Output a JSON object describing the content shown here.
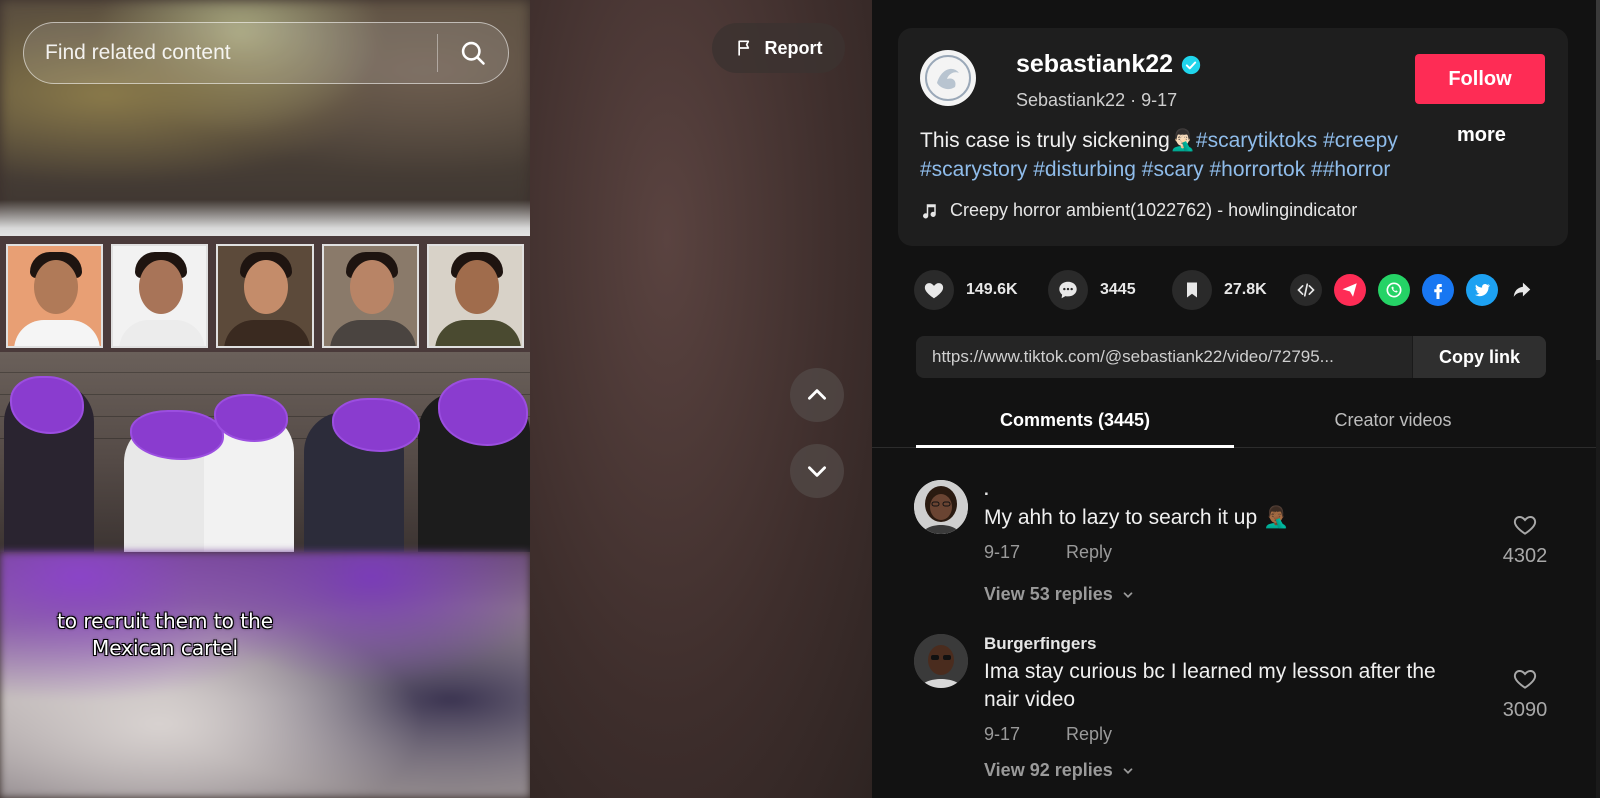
{
  "search": {
    "placeholder": "Find related content"
  },
  "video": {
    "report_label": "Report",
    "caption_line1": "to recruit them to the",
    "caption_line2": "Mexican cartel"
  },
  "author": {
    "username": "sebastiank22",
    "display_name": "Sebastiank22",
    "date": "9-17",
    "separator": "·",
    "follow_label": "Follow",
    "description_text": "This case is truly sickening🤦🏻‍♂️",
    "hashtags": [
      "#scarytiktoks",
      "#creepy",
      "#scarystory",
      "#disturbing",
      "#scary",
      "#horrortok",
      "##horror"
    ],
    "more_label": "more",
    "music": "Creepy horror ambient(1022762) - howlingindicator"
  },
  "actions": {
    "likes": "149.6K",
    "comments": "3445",
    "saves": "27.8K"
  },
  "share_icons": [
    "embed-icon",
    "send-icon",
    "whatsapp-icon",
    "facebook-icon",
    "twitter-icon",
    "share-arrow-icon"
  ],
  "colors": {
    "accent": "#fe2c55",
    "hashtag": "#8fbcea",
    "verified": "#20d5ec",
    "whatsapp": "#25d366",
    "facebook": "#1877f2",
    "twitter": "#1da1f2"
  },
  "link": {
    "url": "https://www.tiktok.com/@sebastiank22/video/72795...",
    "copy_label": "Copy link"
  },
  "tabs": {
    "comments_label": "Comments (3445)",
    "creator_label": "Creator videos"
  },
  "comments": [
    {
      "user": ".",
      "text": "My ahh to lazy to search it up 🤦🏾‍♂️",
      "date": "9-17",
      "reply_label": "Reply",
      "likes": "4302",
      "replies_label": "View 53 replies"
    },
    {
      "user": "Burgerfingers",
      "text": "Ima stay curious bc I learned my lesson after the nair video",
      "date": "9-17",
      "reply_label": "Reply",
      "likes": "3090",
      "replies_label": "View 92 replies"
    }
  ]
}
